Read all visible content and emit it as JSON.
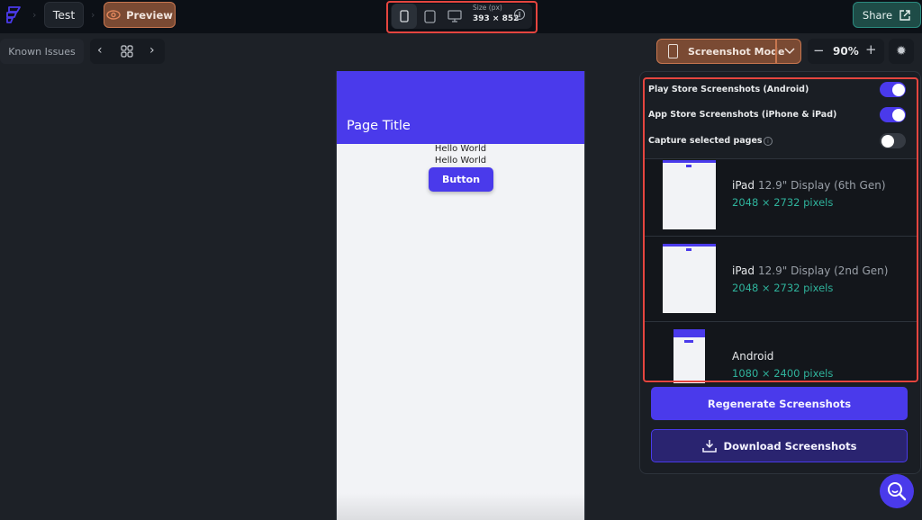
{
  "topbar": {
    "breadcrumb_project": "Test",
    "preview_label": "Preview",
    "device_size_label": "Size (px)",
    "device_size_value": "393 × 852",
    "share_label": "Share"
  },
  "toolbar": {
    "known_issues_label": "Known Issues",
    "screenshot_mode_label": "Screenshot Mode",
    "zoom_level": "90%"
  },
  "preview": {
    "page_title": "Page Title",
    "text_lines": [
      "Hello World",
      "Hello World"
    ],
    "button_label": "Button"
  },
  "screenshot_panel": {
    "options": [
      {
        "label": "Play Store Screenshots (Android)",
        "enabled": true
      },
      {
        "label": "App Store Screenshots (iPhone & iPad)",
        "enabled": true
      },
      {
        "label": "Capture selected pages",
        "enabled": false
      }
    ],
    "devices": [
      {
        "name": "iPad",
        "detail": "12.9\" Display (6th Gen)",
        "resolution": "2048 × 2732 pixels"
      },
      {
        "name": "iPad",
        "detail": "12.9\" Display (2nd Gen)",
        "resolution": "2048 × 2732 pixels"
      },
      {
        "name": "Android",
        "detail": "",
        "resolution": "1080 × 2400 pixels"
      }
    ],
    "regenerate_label": "Regenerate Screenshots",
    "download_label": "Download Screenshots"
  },
  "colors": {
    "accent": "#4a3aeb",
    "preview_orange": "#c7764f",
    "share_teal": "#2b8a7f",
    "resolution_green": "#2fb39c",
    "highlight_red": "#e5453f"
  }
}
